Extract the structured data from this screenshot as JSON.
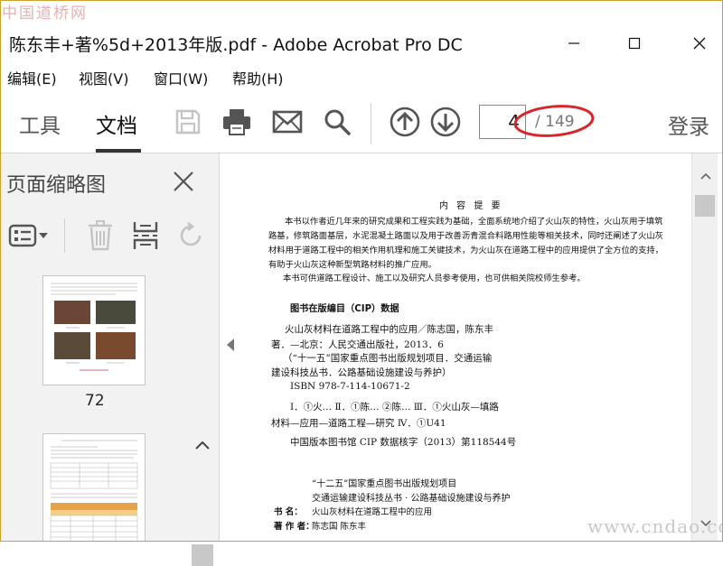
{
  "watermark_top": "中国道桥网",
  "watermark_bottom": "www.cndao.com",
  "window": {
    "title": "陈东丰+著%5d+2013年版.pdf - Adobe Acrobat Pro DC"
  },
  "menu": [
    {
      "label": "编辑(E)"
    },
    {
      "label": "视图(V)"
    },
    {
      "label": "窗口(W)"
    },
    {
      "label": "帮助(H)"
    }
  ],
  "toolbar": {
    "tab_tools": "工具",
    "tab_document": "文档",
    "current_page": "4",
    "total_pages": "/ 149",
    "login": "登录",
    "icons": [
      "save-icon",
      "print-icon",
      "email-icon",
      "search-icon",
      "page-up-icon",
      "page-down-icon"
    ]
  },
  "thumbnail_panel": {
    "title": "页面缩略图",
    "page_labels": [
      "72"
    ]
  },
  "document": {
    "heading": "内 容 提 要",
    "abstract_lines": [
      "本书以作者近几年来的研究成果和工程实践为基础，全面系统地介绍了火山灰的特性，火山灰用于填筑",
      "路基，修筑路面基层，水泥混凝土路面以及用于改善沥青混合料路用性能等相关技术，同时还阐述了火山灰",
      "材料用于道路工程中的相关作用机理和施工关键技术，为火山灰在道路工程中的应用提供了全方位的支持，",
      "有助于火山灰这种新型筑路材料的推广应用。"
    ],
    "audience": "本书可供道路工程设计、施工以及研究人员参考使用，也可供相关院校师生参考。",
    "cip_title": "图书在版编目（CIP）数据",
    "cip_lines": [
      "火山灰材料在道路工程中的应用／陈志国，陈东丰",
      "著．—北京：人民交通出版社，2013．6",
      "（“十一五”国家重点图书出版规划项目．交通运输",
      "建设科技丛书．公路基础设施建设与养护）",
      "ISBN  978-7-114-10671-2",
      "Ⅰ．①火…  Ⅱ．①陈…  ②陈…  Ⅲ．①火山灰—填路",
      "材料—应用—道路工程—研究  Ⅳ．①U41",
      "中国版本图书馆 CIP 数据核字（2013）第118544号"
    ],
    "project_lines": [
      "“十二五”国家重点图书出版规划项目",
      "交通运输建设科技丛书 · 公路基础设施建设与养护"
    ],
    "book_title_label": "书    名：",
    "book_title": "火山灰材料在道路工程中的应用",
    "author_label": "著 作 者：",
    "authors": "陈志国   陈东丰"
  }
}
